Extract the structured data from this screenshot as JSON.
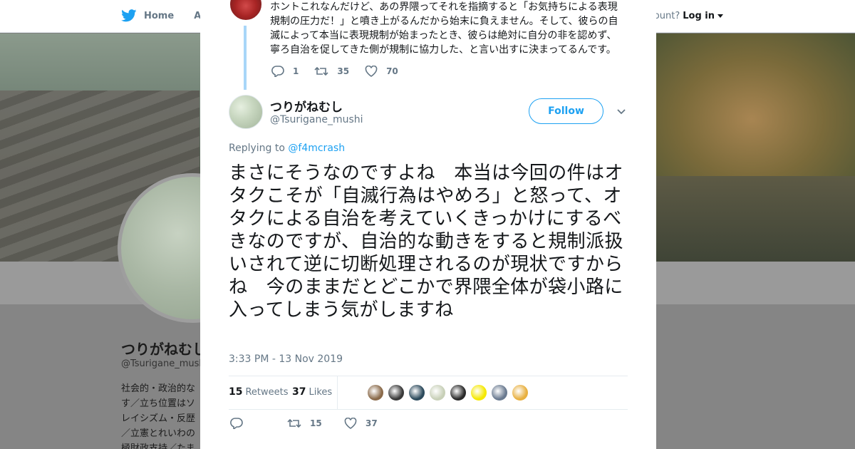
{
  "background": {
    "nav": {
      "home_label": "Home",
      "about_label": "Abo"
    },
    "account": {
      "question": "ccount?",
      "login_label": "Log in"
    },
    "profile": {
      "name": "つりがねむし",
      "handle": "@Tsurigane_mushi",
      "bio_lines": [
        "社会的・政治的な",
        "す／立ち位置はソ",
        "レイシズム・反歴",
        "／立憲とれいわの",
        "極財政支持／たま"
      ]
    }
  },
  "modal": {
    "parent_tweet": {
      "text": "ホントこれなんだけど、あの界隈ってそれを指摘すると「お気持ちによる表現規制の圧力だ！」と噴き上がるんだから始末に負えません。そして、彼らの自滅によって本当に表現規制が始まったとき、彼らは絶対に自分の非を認めず、寧ろ自治を促してきた側が規制に協力した、と言い出すに決まってるんです。",
      "replies": "1",
      "retweets": "35",
      "likes": "70"
    },
    "tweet": {
      "author_name": "つりがねむし",
      "author_handle": "@Tsurigane_mushi",
      "follow_label": "Follow",
      "replying_prefix": "Replying to",
      "replying_to": "@f4mcrash",
      "text": "まさにそうなのですよね　本当は今回の件はオタクこそが「自滅行為はやめろ」と怒って、オタクによる自治を考えていくきっかけにするべきなのですが、自治的な動きをすると規制派扱いされて逆に切断処理されるのが現状ですからね　今のままだとどこかで界隈全体が袋小路に入ってしまう気がしますね",
      "timestamp": "3:33 PM - 13 Nov 2019",
      "retweets_count": "15",
      "retweets_label": "Retweets",
      "likes_count": "37",
      "likes_label": "Likes",
      "liker_colors": [
        "#8a6a4a",
        "#3a3a3a",
        "#2c4a5c",
        "#c8d0b8",
        "#2a2a2a",
        "#f5e800",
        "#6a7a90",
        "#e8b040"
      ],
      "action_replies": "",
      "action_retweets": "15",
      "action_likes": "37"
    }
  },
  "colors": {
    "accent": "#1da1f2",
    "muted": "#657786",
    "thread": "#a8d6f8"
  }
}
